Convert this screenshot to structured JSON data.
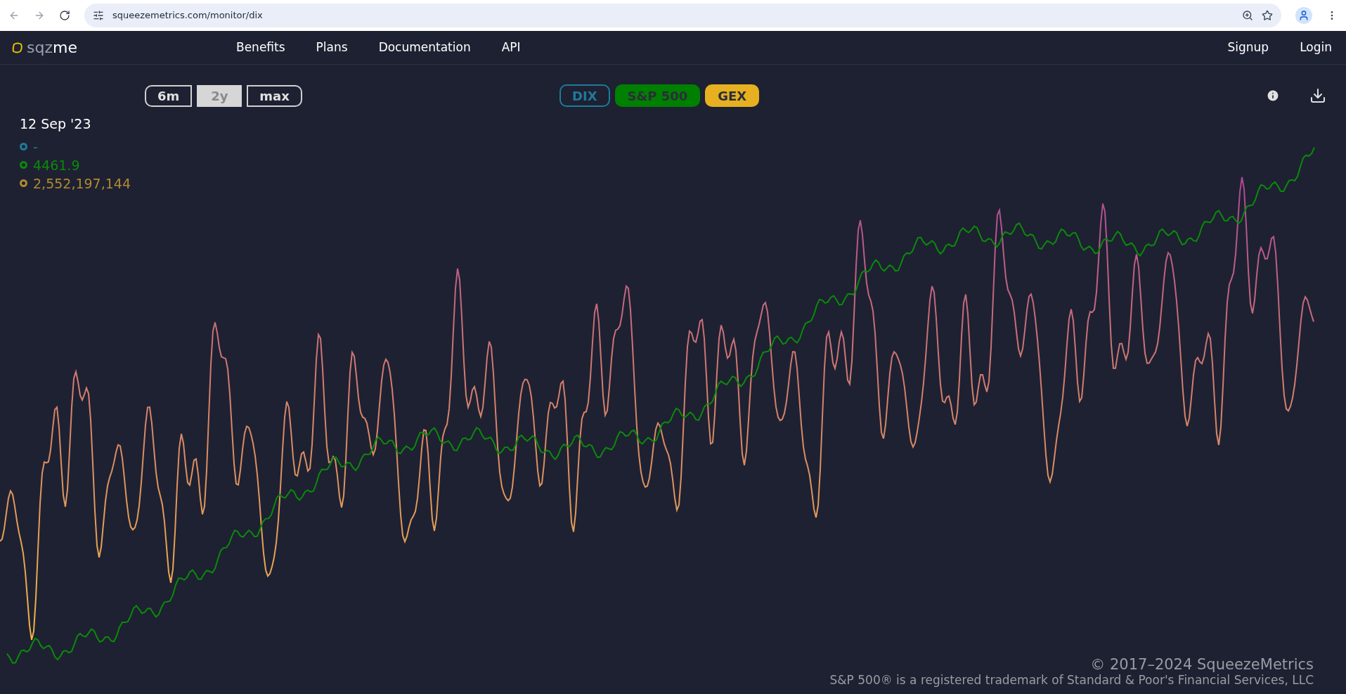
{
  "browser": {
    "url": "squeezemetrics.com/monitor/dix"
  },
  "nav": {
    "logo": {
      "parts": [
        "sqz",
        "me"
      ]
    },
    "links": [
      "Benefits",
      "Plans",
      "Documentation",
      "API"
    ],
    "account": [
      "Signup",
      "Login"
    ]
  },
  "ranges": [
    {
      "label": "6m",
      "selected": false
    },
    {
      "label": "2y",
      "selected": true
    },
    {
      "label": "max",
      "selected": false
    }
  ],
  "series": [
    {
      "label": "DIX",
      "selected": false,
      "color": "#1f7a9c"
    },
    {
      "label": "S&P 500",
      "selected": true,
      "color": "#008000"
    },
    {
      "label": "GEX",
      "selected": true,
      "color": "#e6b020"
    }
  ],
  "legend": {
    "date": "12 Sep '23",
    "values": [
      {
        "text": "-",
        "color": "#1f7a9c"
      },
      {
        "text": "4461.9",
        "color": "#0a8a0a"
      },
      {
        "text": "2,552,197,144",
        "color": "#b08a30"
      }
    ]
  },
  "footer": {
    "copyright": "© 2017–2024 SqueezeMetrics",
    "trademark": "S&P 500® is a registered trademark of Standard & Poor's Financial Services, LLC"
  }
}
